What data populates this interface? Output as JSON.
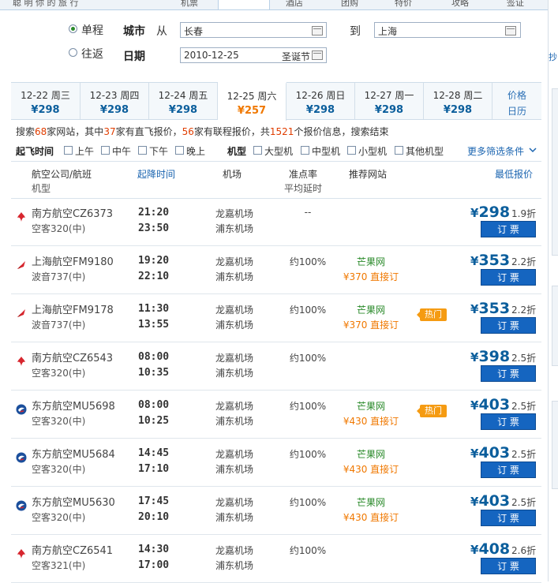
{
  "top_nav": [
    "聪 明 你 的 旅 行",
    "机票",
    "酒店",
    "团购",
    "特价",
    "攻略",
    "签证"
  ],
  "search": {
    "trip_types": [
      {
        "label": "单程",
        "selected": true
      },
      {
        "label": "往返",
        "selected": false
      }
    ],
    "city_label": "城市",
    "from_label": "从",
    "from_value": "长春",
    "to_label": "到",
    "to_value": "上海",
    "date_label": "日期",
    "date_value": "2010-12-25",
    "date_note": "圣诞节"
  },
  "date_tabs": [
    {
      "date": "12-22 周三",
      "price": "¥298"
    },
    {
      "date": "12-23 周四",
      "price": "¥298"
    },
    {
      "date": "12-24 周五",
      "price": "¥298"
    },
    {
      "date": "12-25 周六",
      "price": "¥257",
      "active": true
    },
    {
      "date": "12-26 周日",
      "price": "¥298"
    },
    {
      "date": "12-27 周一",
      "price": "¥298"
    },
    {
      "date": "12-28 周二",
      "price": "¥298"
    }
  ],
  "price_calendar": {
    "line1": "价格",
    "line2": "日历"
  },
  "summary": {
    "p1": "搜索",
    "n1": "68",
    "p2": "家网站，其中",
    "n2": "37",
    "p3": "家有直飞报价，",
    "n3": "56",
    "p4": "家有联程报价，共",
    "n4": "1521",
    "p5": "个报价信息，搜索结束"
  },
  "filters": {
    "time_label": "起飞时间",
    "time_options": [
      "上午",
      "中午",
      "下午",
      "晚上"
    ],
    "model_label": "机型",
    "model_options": [
      "大型机",
      "中型机",
      "小型机",
      "其他机型"
    ],
    "more": "更多筛选条件"
  },
  "table_header": {
    "airline": "航空公司/航班",
    "model": "机型",
    "time": "起降时间",
    "airport": "机场",
    "ontime": "准点率",
    "delay": "平均延时",
    "site": "推荐网站",
    "price": "最低报价"
  },
  "flights": [
    {
      "airline": "南方航空CZ6373",
      "model": "空客320(中)",
      "dep": "21:20",
      "arr": "23:50",
      "from": "龙嘉机场",
      "to": "浦东机场",
      "rate": "--",
      "site": "",
      "site_price": "",
      "hot": "",
      "price": "298",
      "discount": "1.9折",
      "logo": "china-southern",
      "book": "订 票"
    },
    {
      "airline": "上海航空FM9180",
      "model": "波音737(中)",
      "dep": "19:20",
      "arr": "22:10",
      "from": "龙嘉机场",
      "to": "浦东机场",
      "rate": "约100%",
      "site": "芒果网",
      "site_price": "¥370 直接订",
      "hot": "",
      "price": "353",
      "discount": "2.2折",
      "logo": "shanghai-airlines",
      "book": "订 票"
    },
    {
      "airline": "上海航空FM9178",
      "model": "波音737(中)",
      "dep": "11:30",
      "arr": "13:55",
      "from": "龙嘉机场",
      "to": "浦东机场",
      "rate": "约100%",
      "site": "芒果网",
      "site_price": "¥370 直接订",
      "hot": "热门",
      "price": "353",
      "discount": "2.2折",
      "logo": "shanghai-airlines",
      "book": "订 票"
    },
    {
      "airline": "南方航空CZ6543",
      "model": "空客320(中)",
      "dep": "08:00",
      "arr": "10:35",
      "from": "龙嘉机场",
      "to": "浦东机场",
      "rate": "约100%",
      "site": "",
      "site_price": "",
      "hot": "",
      "price": "398",
      "discount": "2.5折",
      "logo": "china-southern",
      "book": "订 票"
    },
    {
      "airline": "东方航空MU5698",
      "model": "空客320(中)",
      "dep": "08:00",
      "arr": "10:25",
      "from": "龙嘉机场",
      "to": "浦东机场",
      "rate": "约100%",
      "site": "芒果网",
      "site_price": "¥430 直接订",
      "hot": "热门",
      "price": "403",
      "discount": "2.5折",
      "logo": "china-eastern",
      "book": "订 票"
    },
    {
      "airline": "东方航空MU5684",
      "model": "空客320(中)",
      "dep": "14:45",
      "arr": "17:10",
      "from": "龙嘉机场",
      "to": "浦东机场",
      "rate": "约100%",
      "site": "芒果网",
      "site_price": "¥430 直接订",
      "hot": "",
      "price": "403",
      "discount": "2.5折",
      "logo": "china-eastern",
      "book": "订 票"
    },
    {
      "airline": "东方航空MU5630",
      "model": "空客320(中)",
      "dep": "17:45",
      "arr": "20:10",
      "from": "龙嘉机场",
      "to": "浦东机场",
      "rate": "约100%",
      "site": "芒果网",
      "site_price": "¥430 直接订",
      "hot": "",
      "price": "403",
      "discount": "2.5折",
      "logo": "china-eastern",
      "book": "订 票"
    },
    {
      "airline": "南方航空CZ6541",
      "model": "空客321(中)",
      "dep": "14:30",
      "arr": "17:00",
      "from": "龙嘉机场",
      "to": "浦东机场",
      "rate": "约100%",
      "site": "",
      "site_price": "",
      "hot": "",
      "price": "408",
      "discount": "2.6折",
      "logo": "china-southern",
      "book": "订 票"
    }
  ],
  "colors": {
    "accent": "#0b5e9c",
    "orange": "#f07800",
    "button": "#1565c0",
    "hot": "#f59b12",
    "green": "#2a8a2a"
  },
  "currency": "¥"
}
